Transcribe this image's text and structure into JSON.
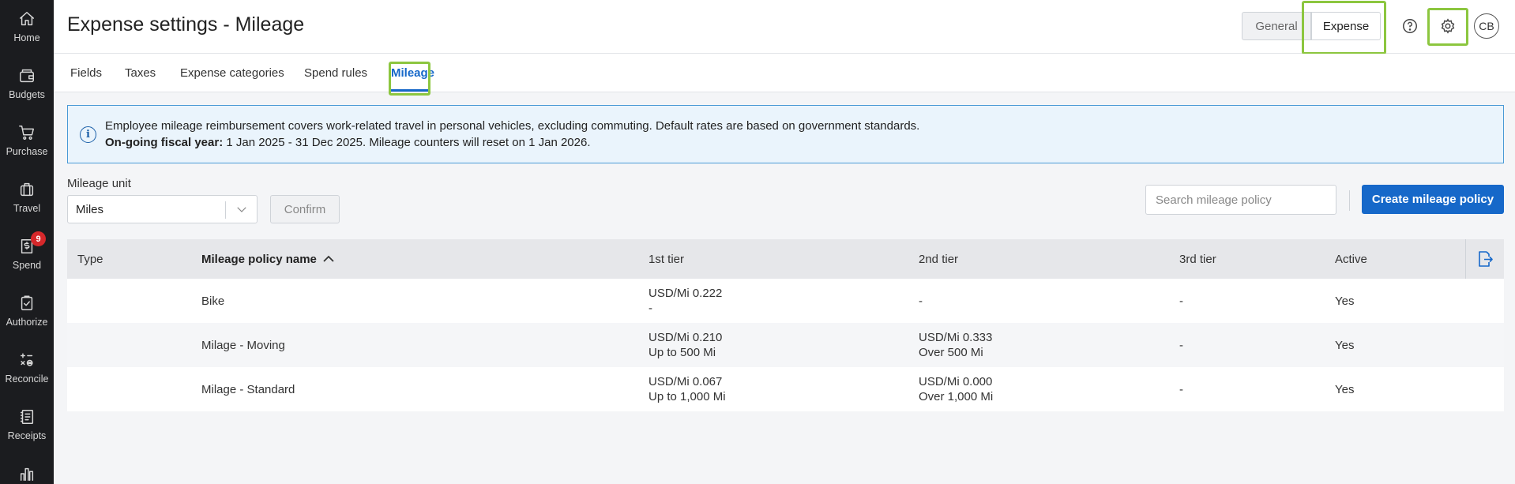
{
  "nav": {
    "items": [
      {
        "label": "Home",
        "icon": "home-icon"
      },
      {
        "label": "Budgets",
        "icon": "wallet-icon"
      },
      {
        "label": "Purchase",
        "icon": "cart-icon"
      },
      {
        "label": "Travel",
        "icon": "suitcase-icon"
      },
      {
        "label": "Spend",
        "icon": "receipt-dollar-icon",
        "badge": "9"
      },
      {
        "label": "Authorize",
        "icon": "clipboard-check-icon"
      },
      {
        "label": "Reconcile",
        "icon": "calculator-icon"
      },
      {
        "label": "Receipts",
        "icon": "receipt-book-icon"
      },
      {
        "label": "",
        "icon": "bar-chart-icon"
      }
    ]
  },
  "header": {
    "title": "Expense settings - Mileage",
    "toggle": {
      "general": "General",
      "expense": "Expense"
    },
    "help": "?",
    "avatar": "CB"
  },
  "tabs": [
    {
      "label": "Fields"
    },
    {
      "label": "Taxes"
    },
    {
      "label": "Expense categories"
    },
    {
      "label": "Spend rules"
    },
    {
      "label": "Mileage",
      "active": true
    }
  ],
  "banner": {
    "line1": "Employee mileage reimbursement covers work-related travel in personal vehicles, excluding commuting. Default rates are based on government standards.",
    "fiscal_label": "On-going fiscal year:",
    "fiscal_text": " 1 Jan 2025 - 31 Dec 2025. Mileage counters will reset on 1 Jan 2026."
  },
  "mileage_unit": {
    "label": "Mileage unit",
    "value": "Miles",
    "confirm": "Confirm"
  },
  "search": {
    "placeholder": "Search mileage policy"
  },
  "create_button": "Create mileage policy",
  "table": {
    "headers": {
      "type": "Type",
      "name": "Mileage policy name",
      "tier1": "1st tier",
      "tier2": "2nd tier",
      "tier3": "3rd tier",
      "active": "Active"
    },
    "rows": [
      {
        "type": "",
        "name": "Bike",
        "tier1_rate": "USD/Mi 0.222",
        "tier1_limit": "-",
        "tier2_rate": "-",
        "tier2_limit": "",
        "tier3": "-",
        "active": "Yes"
      },
      {
        "type": "",
        "name": "Milage - Moving",
        "tier1_rate": "USD/Mi 0.210",
        "tier1_limit": "Up to 500 Mi",
        "tier2_rate": "USD/Mi 0.333",
        "tier2_limit": "Over 500 Mi",
        "tier3": "-",
        "active": "Yes"
      },
      {
        "type": "",
        "name": "Milage - Standard",
        "tier1_rate": "USD/Mi 0.067",
        "tier1_limit": "Up to 1,000 Mi",
        "tier2_rate": "USD/Mi 0.000",
        "tier2_limit": "Over 1,000 Mi",
        "tier3": "-",
        "active": "Yes"
      }
    ]
  },
  "colors": {
    "accent": "#1668c9",
    "highlight": "#8cc63f",
    "nav_bg": "#1b1c1f",
    "badge": "#d6282b"
  }
}
